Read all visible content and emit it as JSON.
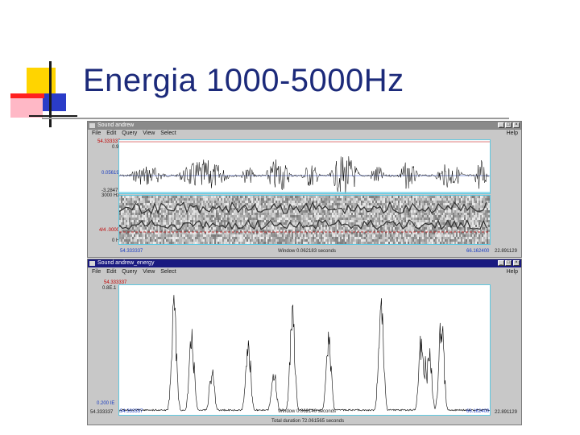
{
  "slide": {
    "title": "Energia 1000-5000Hz"
  },
  "colors": {
    "title_text": "#1c2a7a",
    "bullet_yellow": "#ffd400",
    "bullet_blue": "#2a3cc8",
    "bullet_red": "#ff2020",
    "cursor_red": "#c00000",
    "marker_blue": "#1a3cc0",
    "selection_cyan": "#60c8e0"
  },
  "window_top": {
    "title": "Sound andrew",
    "menu": [
      "File",
      "Edit",
      "Query",
      "View",
      "Select"
    ],
    "help": "Help",
    "waveform": {
      "cursor_value": "54.333337",
      "top_value": "0.96",
      "marker_value": "0.05619",
      "bottom_value": "-3.2847"
    },
    "spectrogram": {
      "top_freq": "3000 Hz",
      "cursor_value": "4/4 .0000",
      "bottom_freq": "0 Hz"
    },
    "status": {
      "left_time": "54.333337",
      "window": "Window 0.062183 seconds",
      "right_marker": "66.162400",
      "right_time": "22.891129"
    }
  },
  "window_bottom": {
    "title": "Sound andrew_energy",
    "menu": [
      "File",
      "Edit",
      "Query",
      "View",
      "Select"
    ],
    "help": "Help",
    "plot": {
      "cursor_value": "54.333337",
      "top_value": "0.8E.1",
      "bottom_value": "0.200 IE",
      "left_time": "54.333337",
      "outer_left": "54.333337",
      "window": "Window 0.062140 seconds",
      "right_marker": "66.162400",
      "right_time": "22.891129",
      "total_duration": "Total duration 72.061565 seconds"
    },
    "icons": [
      "minimize-icon",
      "maximize-icon",
      "close-icon"
    ]
  }
}
